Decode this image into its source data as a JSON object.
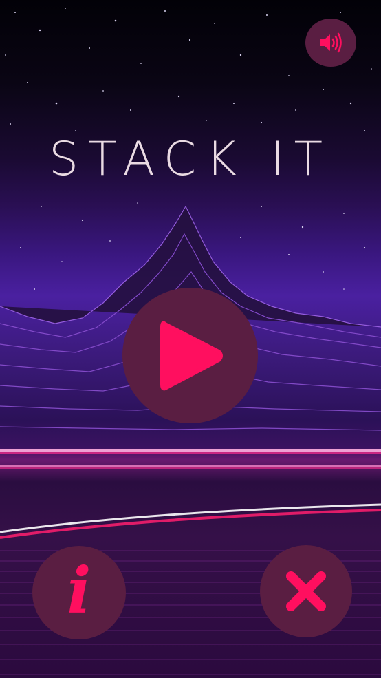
{
  "game": {
    "title": "STACK IT"
  },
  "controls": {
    "sound": {
      "icon": "speaker-on-icon"
    },
    "play": {
      "icon": "play-icon"
    },
    "info": {
      "icon": "info-icon",
      "glyph": "i"
    },
    "close": {
      "icon": "close-x-icon"
    }
  },
  "theme": {
    "accent": "#ff0f5f",
    "button_bg": "#5a1e42",
    "title_color": "#eadbe3"
  }
}
